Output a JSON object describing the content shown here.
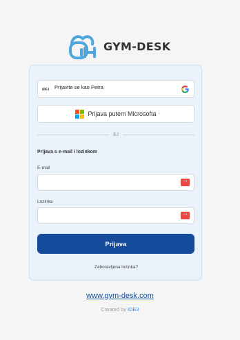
{
  "app": {
    "logo_text": "GYM-DESK",
    "logo_icon": "kettlebell-dumbbell-icon",
    "brand_color": "#4fa6dc"
  },
  "login": {
    "google_label": "Prijavite se kao Petra",
    "google_avatar_text": "IDE3",
    "microsoft_label": "Prijava putem Microsofta",
    "divider_text": "ILI",
    "section_title": "Prijava s e-mail i lozinkom",
    "email_label": "E-mail",
    "email_value": "",
    "password_label": "Lozinka",
    "password_value": "",
    "password_manager_icon": "password-dots-icon",
    "login_button": "Prijava",
    "forgot_password": "Zaboravljena lozinka?",
    "accent_color": "#164a9a"
  },
  "footer": {
    "site_link": "www.gym-desk.com",
    "created_by_prefix": "Created by ",
    "created_by_name": "IDE3"
  }
}
